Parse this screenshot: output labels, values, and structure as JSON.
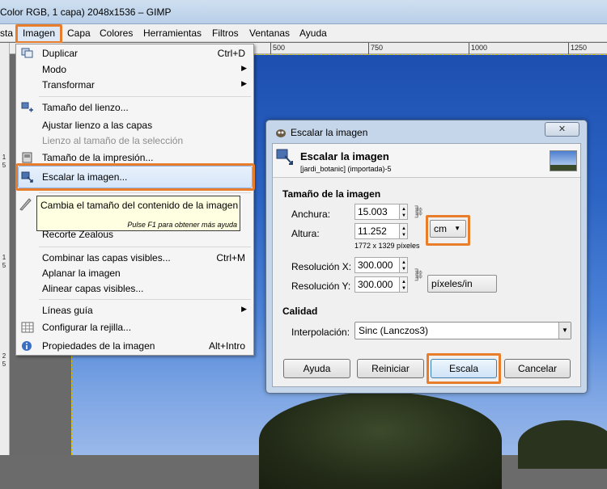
{
  "window": {
    "title": "Color RGB, 1 capa) 2048x1536 – GIMP"
  },
  "menubar": {
    "items": [
      "sta",
      "Imagen",
      "Capa",
      "Colores",
      "Herramientas",
      "Filtros",
      "Ventanas",
      "Ayuda"
    ]
  },
  "ruler": {
    "labels": [
      "500",
      "750",
      "1000",
      "1250"
    ],
    "vlabels": [
      "1",
      "5",
      "1",
      "5",
      "2",
      "5"
    ]
  },
  "image_menu": {
    "items": [
      {
        "label": "Duplicar",
        "shortcut": "Ctrl+D",
        "icon": "duplicate-icon"
      },
      {
        "label": "Modo",
        "submenu": true
      },
      {
        "label": "Transformar",
        "submenu": true
      },
      {
        "label": "Tamaño del lienzo...",
        "icon": "canvas-size-icon"
      },
      {
        "label": "Ajustar lienzo a las capas"
      },
      {
        "label": "Lienzo al tamaño de la selección",
        "disabled": true
      },
      {
        "label": "Tamaño de la impresión...",
        "icon": "print-size-icon"
      },
      {
        "label": "Escalar la imagen...",
        "icon": "scale-image-icon"
      },
      {
        "label": "Recorte Zealous"
      },
      {
        "label": "Combinar las capas visibles...",
        "shortcut": "Ctrl+M"
      },
      {
        "label": "Aplanar la imagen"
      },
      {
        "label": "Alinear capas visibles..."
      },
      {
        "label": "Líneas guía",
        "submenu": true
      },
      {
        "label": "Configurar la rejilla...",
        "icon": "grid-icon"
      },
      {
        "label": "Propiedades de la imagen",
        "shortcut": "Alt+Intro",
        "icon": "info-icon"
      }
    ]
  },
  "tooltip": {
    "text": "Cambia el tamaño del contenido de la imagen",
    "hint": "Pulse F1 para obtener más ayuda"
  },
  "dialog": {
    "window_title": "Escalar la imagen",
    "heading": "Escalar la imagen",
    "subheading": "[jardi_botanic] (importada)-5",
    "section_size": "Tamaño de la imagen",
    "width_label": "Anchura:",
    "width_value": "15.003",
    "height_label": "Altura:",
    "height_value": "11.252",
    "unit": "cm",
    "pixels_info": "1772 x 1329 píxeles",
    "resx_label": "Resolución X:",
    "resx_value": "300.000",
    "resy_label": "Resolución Y:",
    "resy_value": "300.000",
    "res_unit": "píxeles/in",
    "section_quality": "Calidad",
    "interp_label": "Interpolación:",
    "interp_value": "Sinc (Lanczos3)",
    "buttons": {
      "help": "Ayuda",
      "reset": "Reiniciar",
      "scale": "Escala",
      "cancel": "Cancelar"
    }
  },
  "colors": {
    "accent_highlight": "#e87d2c",
    "dialog_frame": "#c6d6ea",
    "sky": "#2c64c4"
  }
}
